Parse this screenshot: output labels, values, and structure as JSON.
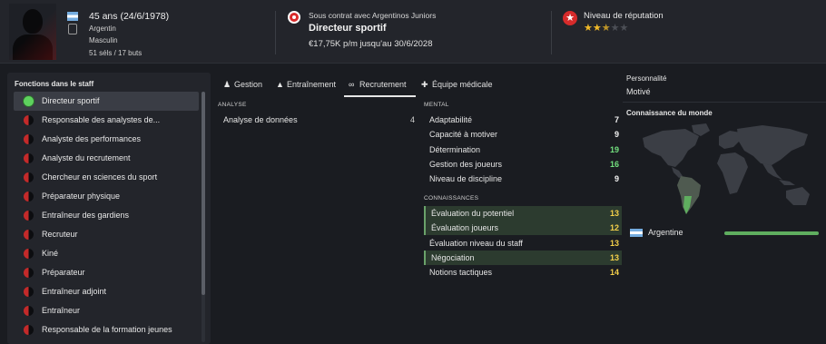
{
  "header": {
    "age_line": "45 ans (24/6/1978)",
    "nationality": "Argentin",
    "gender": "Masculin",
    "caps": "51 séls / 17 buts",
    "contract": "Sous contrat avec Argentinos Juniors",
    "role": "Directeur sportif",
    "wage": "€17,75K p/m jusqu'au 30/6/2028",
    "reputation_label": "Niveau de réputation",
    "reputation_stars": 2.5,
    "reputation_max": 5
  },
  "colors": {
    "accent_red": "#d62b2b",
    "good": "#73e07f",
    "ok": "#f4d04a",
    "country_bar": "#5fae5f"
  },
  "staff": {
    "title": "Fonctions dans le staff",
    "items": [
      {
        "label": "Directeur sportif",
        "active": true
      },
      {
        "label": "Responsable des analystes de...",
        "active": false
      },
      {
        "label": "Analyste des performances",
        "active": false
      },
      {
        "label": "Analyste du recrutement",
        "active": false
      },
      {
        "label": "Chercheur en sciences du sport",
        "active": false
      },
      {
        "label": "Préparateur physique",
        "active": false
      },
      {
        "label": "Entraîneur des gardiens",
        "active": false
      },
      {
        "label": "Recruteur",
        "active": false
      },
      {
        "label": "Kiné",
        "active": false
      },
      {
        "label": "Préparateur",
        "active": false
      },
      {
        "label": "Entraîneur adjoint",
        "active": false
      },
      {
        "label": "Entraîneur",
        "active": false
      },
      {
        "label": "Responsable de la formation jeunes",
        "active": false
      }
    ]
  },
  "tabs": [
    {
      "label": "Gestion",
      "icon": "person-icon"
    },
    {
      "label": "Entraînement",
      "icon": "cone-icon"
    },
    {
      "label": "Recrutement",
      "icon": "binoculars-icon",
      "active": true
    },
    {
      "label": "Équipe médicale",
      "icon": "medical-kit-icon"
    }
  ],
  "analysis": {
    "heading": "ANALYSE",
    "rows": [
      {
        "name": "Analyse de données",
        "value": "4"
      }
    ]
  },
  "mental": {
    "heading": "MENTAL",
    "rows": [
      {
        "name": "Adaptabilité",
        "value": "7"
      },
      {
        "name": "Capacité à motiver",
        "value": "9"
      },
      {
        "name": "Détermination",
        "value": "19"
      },
      {
        "name": "Gestion des joueurs",
        "value": "16"
      },
      {
        "name": "Niveau de discipline",
        "value": "9"
      }
    ]
  },
  "knowledge": {
    "heading": "CONNAISSANCES",
    "rows": [
      {
        "name": "Évaluation du potentiel",
        "value": "13",
        "highlight": true
      },
      {
        "name": "Évaluation joueurs",
        "value": "12",
        "highlight": true
      },
      {
        "name": "Évaluation niveau du staff",
        "value": "13",
        "highlight": false
      },
      {
        "name": "Négociation",
        "value": "13",
        "highlight": true
      },
      {
        "name": "Notions tactiques",
        "value": "14",
        "highlight": false
      }
    ]
  },
  "personality": {
    "label": "Personnalité",
    "value": "Motivé"
  },
  "world_knowledge": {
    "label": "Connaissance du monde",
    "country": "Argentine",
    "level": 1.0
  }
}
